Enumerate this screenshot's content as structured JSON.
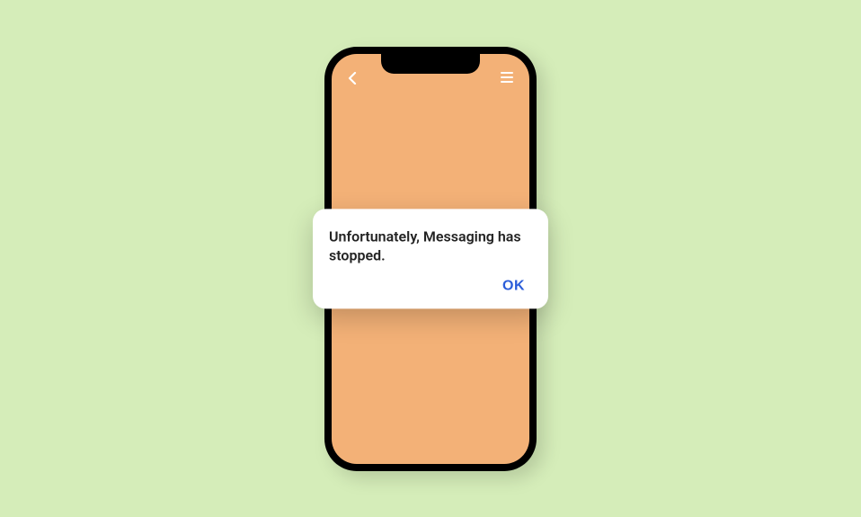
{
  "dialog": {
    "message": "Unfortunately, Messaging has stopped.",
    "ok_label": "OK"
  }
}
